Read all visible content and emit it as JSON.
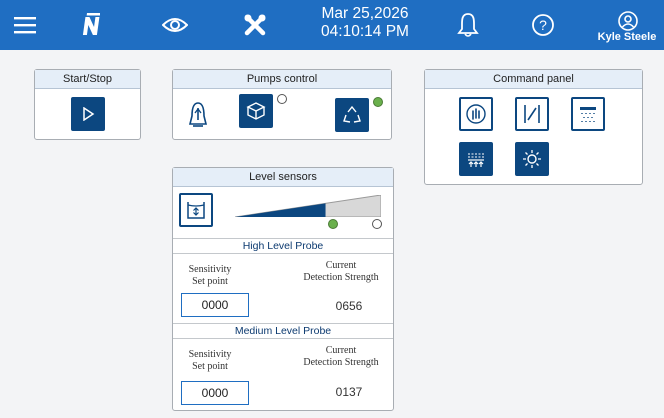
{
  "header": {
    "date": "Mar 25,2026",
    "time": "04:10:14 PM",
    "user_name": "Kyle Steele",
    "colors": {
      "bar": "#1f6ec2",
      "button": "#0c4780"
    },
    "icons": [
      "menu-icon",
      "logo-icon",
      "eye-icon",
      "tools-icon",
      "bell-icon",
      "help-icon",
      "user-icon"
    ]
  },
  "start_stop": {
    "title": "Start/Stop",
    "icon": "play-icon"
  },
  "pumps": {
    "title": "Pumps control",
    "items": [
      {
        "icon": "bell-pump-icon",
        "status": "none"
      },
      {
        "icon": "box-pump-icon",
        "status": "off"
      },
      {
        "icon": "recycle-pump-icon",
        "status": "on"
      }
    ]
  },
  "command_panel": {
    "title": "Command panel",
    "icons": [
      "touch-hand-icon",
      "valve-icon",
      "shower-icon",
      "heat-up-icon",
      "light-icon"
    ]
  },
  "level_sensors": {
    "title": "Level sensors",
    "level_fill": 0.62,
    "indicators": [
      "on",
      "off"
    ],
    "high_probe": {
      "title": "High Level Probe",
      "sensitivity_label_1": "Sensitivity",
      "sensitivity_label_2": "Set point",
      "current_label_1": "Current",
      "current_label_2": "Detection Strength",
      "setpoint": "0000",
      "current": "0656"
    },
    "medium_probe": {
      "title": "Medium Level Probe",
      "sensitivity_label_1": "Sensitivity",
      "sensitivity_label_2": "Set point",
      "current_label_1": "Current",
      "current_label_2": "Detection Strength",
      "setpoint": "0000",
      "current": "0137"
    }
  }
}
